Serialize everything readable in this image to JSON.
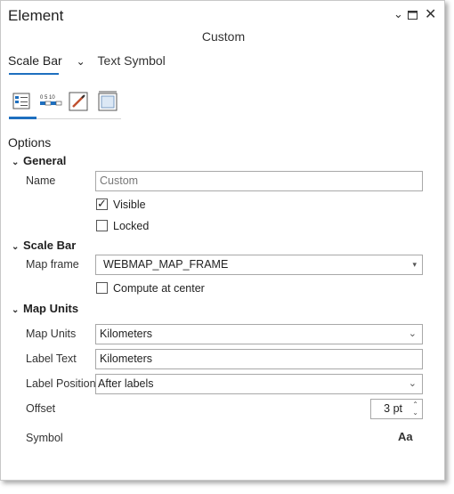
{
  "window": {
    "title": "Element",
    "subtitle": "Custom",
    "controls": [
      "chevron-down-icon",
      "maximize-icon",
      "close-icon"
    ]
  },
  "tabs": {
    "active": "Scale Bar",
    "dropdown": "chevron-down-icon",
    "other": "Text Symbol"
  },
  "icon_tabs": [
    "options-icon",
    "scale-bar-properties-icon",
    "pen-icon",
    "display-icon"
  ],
  "options": {
    "heading": "Options",
    "general": {
      "title": "General",
      "name_label": "Name",
      "name_value": "Custom",
      "visible_label": "Visible",
      "visible_checked": true,
      "locked_label": "Locked",
      "locked_checked": false
    },
    "scale_bar": {
      "title": "Scale Bar",
      "map_frame_label": "Map frame",
      "map_frame_value": "WEBMAP_MAP_FRAME",
      "compute_label": "Compute at center",
      "compute_checked": false
    },
    "map_units": {
      "title": "Map Units",
      "units_label": "Map Units",
      "units_value": "Kilometers",
      "label_text_label": "Label Text",
      "label_text_value": "Kilometers",
      "label_position_label": "Label Position",
      "label_position_value": "After labels",
      "offset_label": "Offset",
      "offset_value": "3 pt",
      "symbol_label": "Symbol",
      "symbol_preview": "Aa"
    }
  },
  "colors": {
    "accent": "#1e6fbf"
  }
}
